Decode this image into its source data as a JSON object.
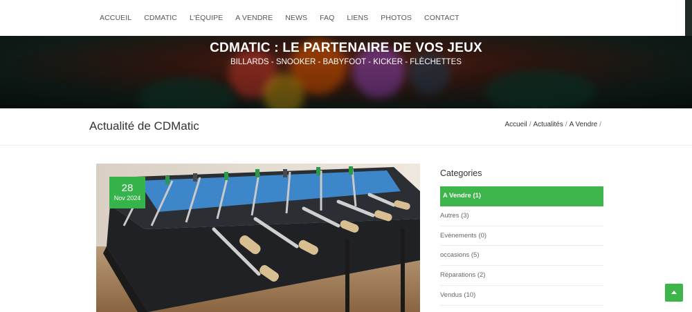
{
  "nav": {
    "items": [
      "ACCUEIL",
      "CDMATIC",
      "L'ÉQUIPE",
      "A VENDRE",
      "NEWS",
      "FAQ",
      "LIENS",
      "PHOTOS",
      "CONTACT"
    ]
  },
  "hero": {
    "title": "CDMATIC : LE PARTENAIRE DE VOS JEUX",
    "subtitle": "BILLARDS - SNOOKER - BABYFOOT - KICKER - FLÈCHETTES"
  },
  "page": {
    "title": "Actualité de CDMatic",
    "breadcrumb": [
      "Accueil",
      "Actualités",
      "A Vendre"
    ]
  },
  "post": {
    "date_day": "28",
    "date_month": "Nov 2024"
  },
  "sidebar": {
    "heading": "Categories",
    "categories": [
      "A Vendre (1)",
      "Autres (3)",
      "Evènements (0)",
      "occasions (5)",
      "Réparations (2)",
      "Vendus (10)"
    ]
  },
  "icons": {
    "back_to_top": "chevron-up-icon"
  },
  "colors": {
    "accent": "#3db54a",
    "nav_text": "#555555",
    "hero_dark": "#12201b"
  }
}
